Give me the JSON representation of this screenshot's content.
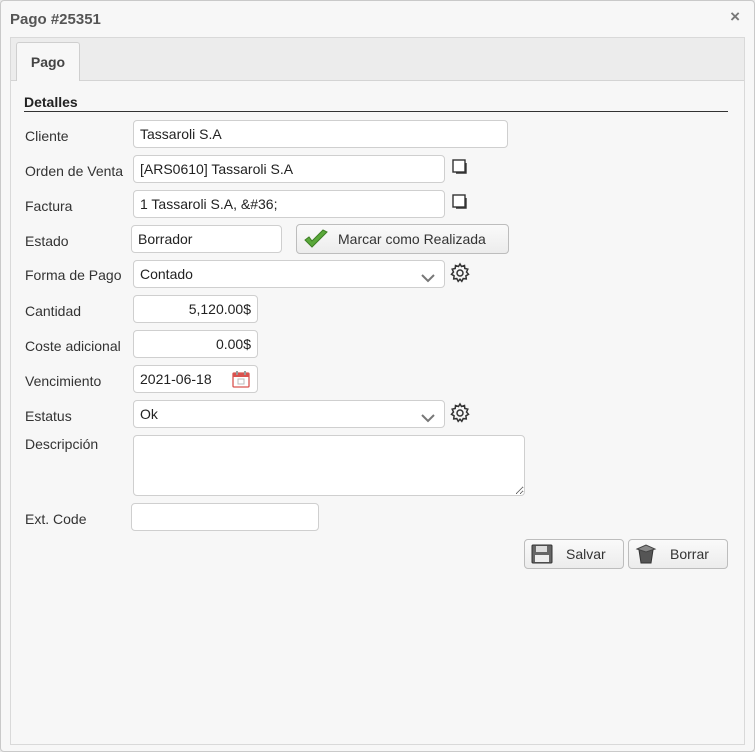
{
  "window": {
    "title": "Pago #25351",
    "close": "×"
  },
  "tabs": [
    {
      "label": "Pago"
    }
  ],
  "section": {
    "title": "Detalles"
  },
  "fields": {
    "cliente": {
      "label": "Cliente",
      "value": "Tassaroli S.A"
    },
    "orden": {
      "label": "Orden de Venta",
      "value": "[ARS0610] Tassaroli S.A"
    },
    "factura": {
      "label": "Factura",
      "value": "1 Tassaroli S.A, &#36;"
    },
    "estado": {
      "label": "Estado",
      "value": "Borrador",
      "action": "Marcar como Realizada"
    },
    "forma_pago": {
      "label": "Forma de Pago",
      "value": "Contado"
    },
    "cantidad": {
      "label": "Cantidad",
      "value": "5,120.00$"
    },
    "coste": {
      "label": "Coste adicional",
      "value": "0.00$"
    },
    "vencimiento": {
      "label": "Vencimiento",
      "value": "2021-06-18"
    },
    "estatus": {
      "label": "Estatus",
      "value": "Ok"
    },
    "descripcion": {
      "label": "Descripción",
      "value": ""
    },
    "ext_code": {
      "label": "Ext. Code",
      "value": ""
    }
  },
  "buttons": {
    "save": "Salvar",
    "delete": "Borrar"
  },
  "icons": {
    "copy": "copy-icon",
    "gear": "gear-icon",
    "check": "check-icon",
    "calendar": "calendar-icon",
    "chevron": "chevron-down-icon",
    "save": "floppy-disk-icon",
    "delete": "trash-icon"
  },
  "colors": {
    "check": "#5aa83a",
    "calendar": "#d9534f",
    "title": "#555555"
  }
}
